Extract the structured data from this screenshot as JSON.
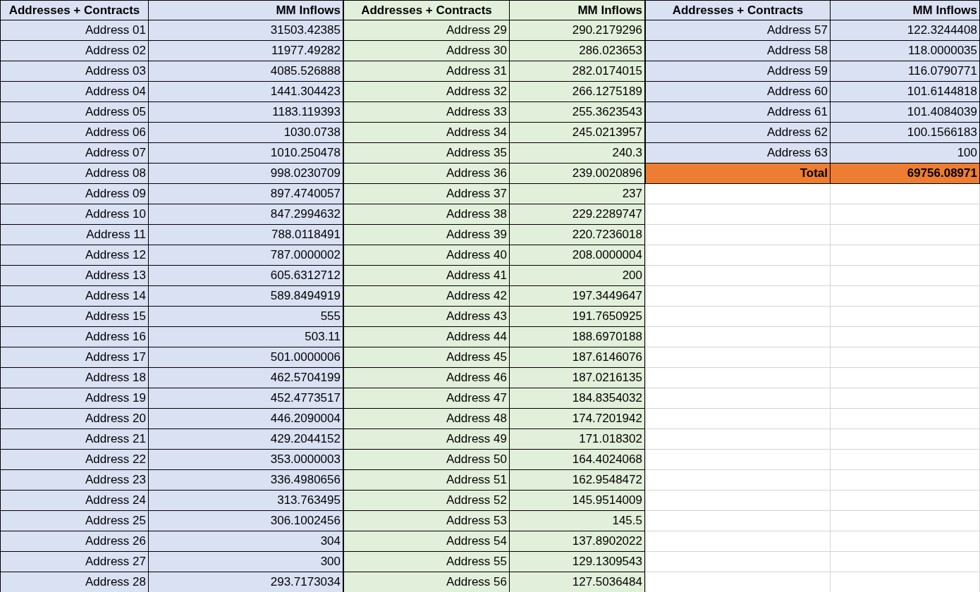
{
  "blocks": [
    {
      "color": "#d9e1f2",
      "columns": [
        "Addresses + Contracts",
        "MM Inflows"
      ],
      "rows": [
        {
          "kind": "entry",
          "name": "Address 01",
          "value": "31503.42385"
        },
        {
          "kind": "entry",
          "name": "Address 02",
          "value": "11977.49282"
        },
        {
          "kind": "entry",
          "name": "Address 03",
          "value": "4085.526888"
        },
        {
          "kind": "entry",
          "name": "Address 04",
          "value": "1441.304423"
        },
        {
          "kind": "entry",
          "name": "Address 05",
          "value": "1183.119393"
        },
        {
          "kind": "entry",
          "name": "Address 06",
          "value": "1030.0738"
        },
        {
          "kind": "entry",
          "name": "Address 07",
          "value": "1010.250478"
        },
        {
          "kind": "entry",
          "name": "Address 08",
          "value": "998.0230709"
        },
        {
          "kind": "entry",
          "name": "Address 09",
          "value": "897.4740057"
        },
        {
          "kind": "entry",
          "name": "Address 10",
          "value": "847.2994632"
        },
        {
          "kind": "entry",
          "name": "Address 11",
          "value": "788.0118491"
        },
        {
          "kind": "entry",
          "name": "Address 12",
          "value": "787.0000002"
        },
        {
          "kind": "entry",
          "name": "Address 13",
          "value": "605.6312712"
        },
        {
          "kind": "entry",
          "name": "Address 14",
          "value": "589.8494919"
        },
        {
          "kind": "entry",
          "name": "Address 15",
          "value": "555"
        },
        {
          "kind": "entry",
          "name": "Address 16",
          "value": "503.11"
        },
        {
          "kind": "entry",
          "name": "Address 17",
          "value": "501.0000006"
        },
        {
          "kind": "entry",
          "name": "Address 18",
          "value": "462.5704199"
        },
        {
          "kind": "entry",
          "name": "Address 19",
          "value": "452.4773517"
        },
        {
          "kind": "entry",
          "name": "Address 20",
          "value": "446.2090004"
        },
        {
          "kind": "entry",
          "name": "Address 21",
          "value": "429.2044152"
        },
        {
          "kind": "entry",
          "name": "Address 22",
          "value": "353.0000003"
        },
        {
          "kind": "entry",
          "name": "Address 23",
          "value": "336.4980656"
        },
        {
          "kind": "entry",
          "name": "Address 24",
          "value": "313.763495"
        },
        {
          "kind": "entry",
          "name": "Address 25",
          "value": "306.1002456"
        },
        {
          "kind": "entry",
          "name": "Address 26",
          "value": "304"
        },
        {
          "kind": "entry",
          "name": "Address 27",
          "value": "300"
        },
        {
          "kind": "entry",
          "name": "Address 28",
          "value": "293.7173034"
        }
      ]
    },
    {
      "color": "#e2efda",
      "columns": [
        "Addresses + Contracts",
        "MM Inflows"
      ],
      "rows": [
        {
          "kind": "entry",
          "name": "Address 29",
          "value": "290.2179296"
        },
        {
          "kind": "entry",
          "name": "Address 30",
          "value": "286.023653"
        },
        {
          "kind": "entry",
          "name": "Address 31",
          "value": "282.0174015"
        },
        {
          "kind": "entry",
          "name": "Address 32",
          "value": "266.1275189"
        },
        {
          "kind": "entry",
          "name": "Address 33",
          "value": "255.3623543"
        },
        {
          "kind": "entry",
          "name": "Address 34",
          "value": "245.0213957"
        },
        {
          "kind": "entry",
          "name": "Address 35",
          "value": "240.3"
        },
        {
          "kind": "entry",
          "name": "Address 36",
          "value": "239.0020896"
        },
        {
          "kind": "entry",
          "name": "Address 37",
          "value": "237"
        },
        {
          "kind": "entry",
          "name": "Address 38",
          "value": "229.2289747"
        },
        {
          "kind": "entry",
          "name": "Address 39",
          "value": "220.7236018"
        },
        {
          "kind": "entry",
          "name": "Address 40",
          "value": "208.0000004"
        },
        {
          "kind": "entry",
          "name": "Address 41",
          "value": "200"
        },
        {
          "kind": "entry",
          "name": "Address 42",
          "value": "197.3449647"
        },
        {
          "kind": "entry",
          "name": "Address 43",
          "value": "191.7650925"
        },
        {
          "kind": "entry",
          "name": "Address 44",
          "value": "188.6970188"
        },
        {
          "kind": "entry",
          "name": "Address 45",
          "value": "187.6146076"
        },
        {
          "kind": "entry",
          "name": "Address 46",
          "value": "187.0216135"
        },
        {
          "kind": "entry",
          "name": "Address 47",
          "value": "184.8354032"
        },
        {
          "kind": "entry",
          "name": "Address 48",
          "value": "174.7201942"
        },
        {
          "kind": "entry",
          "name": "Address 49",
          "value": "171.018302"
        },
        {
          "kind": "entry",
          "name": "Address 50",
          "value": "164.4024068"
        },
        {
          "kind": "entry",
          "name": "Address 51",
          "value": "162.9548472"
        },
        {
          "kind": "entry",
          "name": "Address 52",
          "value": "145.9514009"
        },
        {
          "kind": "entry",
          "name": "Address 53",
          "value": "145.5"
        },
        {
          "kind": "entry",
          "name": "Address 54",
          "value": "137.8902022"
        },
        {
          "kind": "entry",
          "name": "Address 55",
          "value": "129.1309543"
        },
        {
          "kind": "entry",
          "name": "Address 56",
          "value": "127.5036484"
        }
      ]
    },
    {
      "color": "#d9e1f2",
      "columns": [
        "Addresses + Contracts",
        "MM Inflows"
      ],
      "rows": [
        {
          "kind": "entry",
          "name": "Address 57",
          "value": "122.3244408"
        },
        {
          "kind": "entry",
          "name": "Address 58",
          "value": "118.0000035"
        },
        {
          "kind": "entry",
          "name": "Address 59",
          "value": "116.0790771"
        },
        {
          "kind": "entry",
          "name": "Address 60",
          "value": "101.6144818"
        },
        {
          "kind": "entry",
          "name": "Address 61",
          "value": "101.4084039"
        },
        {
          "kind": "entry",
          "name": "Address 62",
          "value": "100.1566183"
        },
        {
          "kind": "entry",
          "name": "Address 63",
          "value": "100"
        },
        {
          "kind": "total",
          "name": "Total",
          "value": "69756.08971",
          "color": "#ed7d31"
        }
      ]
    }
  ]
}
